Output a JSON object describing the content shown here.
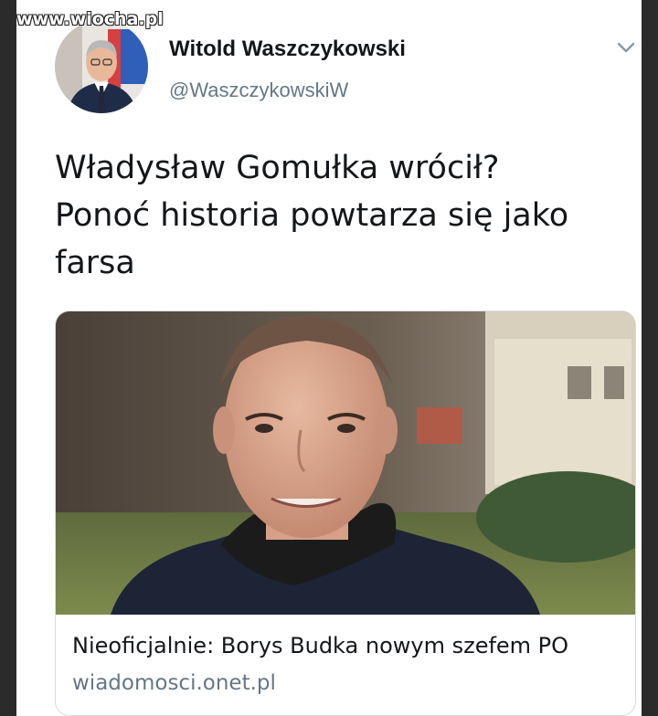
{
  "watermark": "www.wiocha.pl",
  "author": {
    "name": "Witold Waszczykowski",
    "handle": "@WaszczykowskiW"
  },
  "icons": {
    "caret": "chevron-down-icon"
  },
  "tweet": {
    "lines": [
      "Władysław Gomułka wrócił?",
      "Ponoć historia powtarza się jako",
      "farsa"
    ]
  },
  "card": {
    "title": "Nieoficjalnie: Borys Budka nowym szefem PO",
    "domain": "wiadomosci.onet.pl"
  },
  "colors": {
    "name": "#14171a",
    "secondary": "#657786",
    "border": "#d6dde3"
  }
}
